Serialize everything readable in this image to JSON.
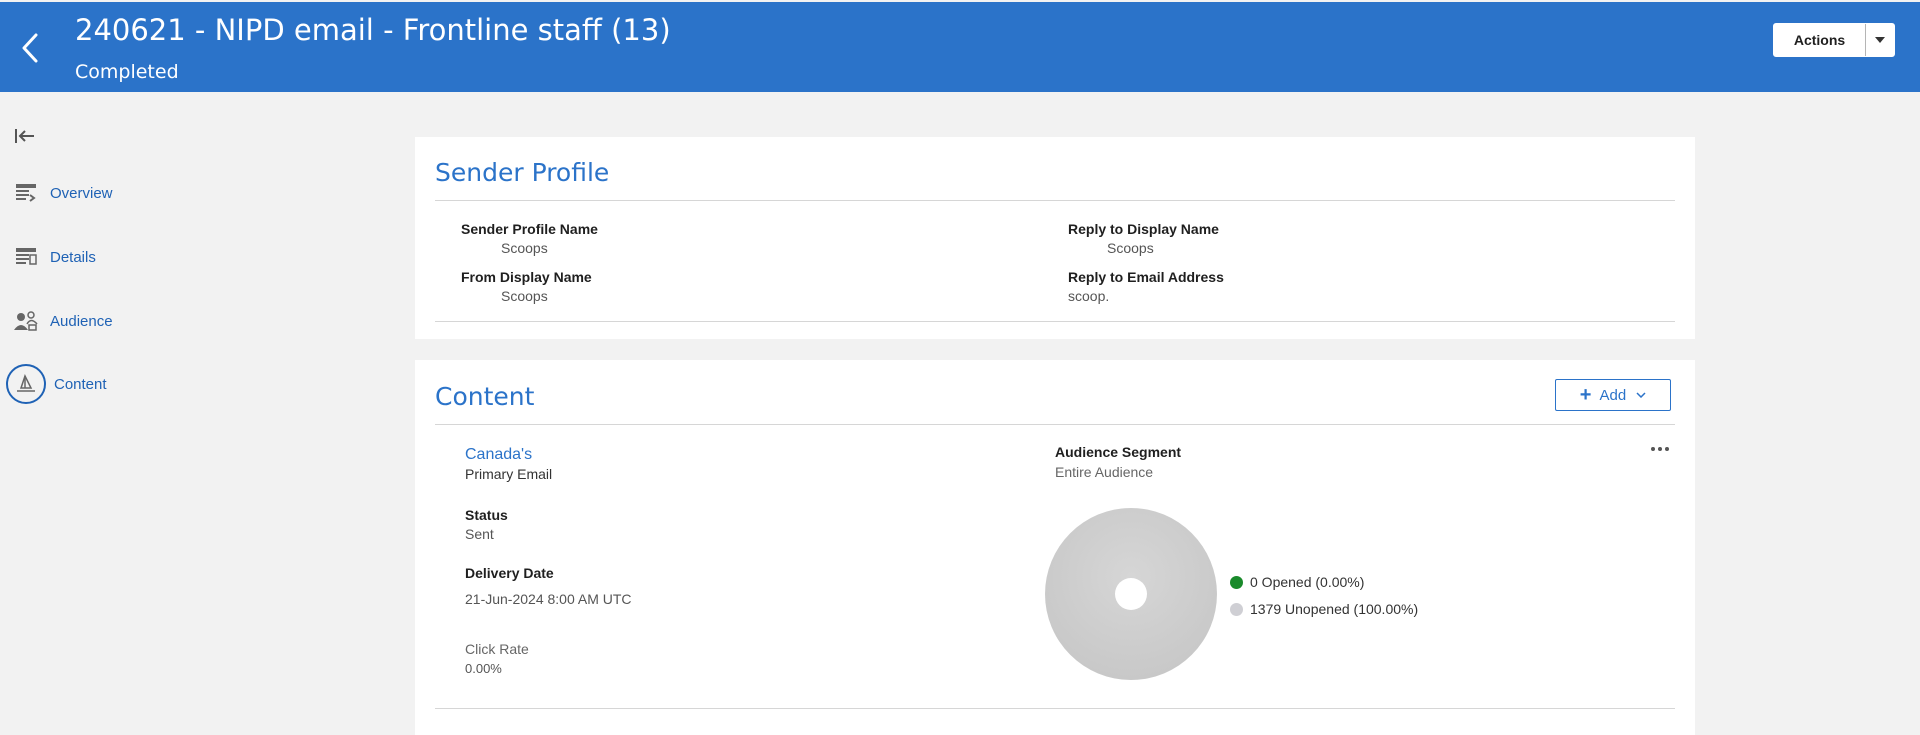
{
  "header": {
    "title": "240621 - NIPD email - Frontline staff (13)",
    "status": "Completed",
    "actions_label": "Actions"
  },
  "sidebar": {
    "items": [
      {
        "label": "Overview",
        "icon": "overview-icon"
      },
      {
        "label": "Details",
        "icon": "details-icon"
      },
      {
        "label": "Audience",
        "icon": "audience-icon"
      },
      {
        "label": "Content",
        "icon": "content-icon",
        "active": true
      }
    ]
  },
  "sender_profile": {
    "title": "Sender Profile",
    "sender_profile_name_label": "Sender Profile Name",
    "sender_profile_name_value": "Scoops",
    "from_display_name_label": "From Display Name",
    "from_display_name_value": "Scoops",
    "reply_to_display_name_label": "Reply to Display Name",
    "reply_to_display_name_value": "Scoops",
    "reply_to_email_label": "Reply to Email Address",
    "reply_to_email_value": "scoop."
  },
  "content": {
    "title": "Content",
    "add_label": "Add",
    "email_name": "Canada's",
    "email_type": "Primary Email",
    "status_label": "Status",
    "status_value": "Sent",
    "delivery_date_label": "Delivery Date",
    "delivery_date_value": "21-Jun-2024 8:00 AM UTC",
    "click_rate_label": "Click Rate",
    "click_rate_value": "0.00%",
    "audience_segment_label": "Audience Segment",
    "audience_segment_value": "Entire Audience"
  },
  "chart_data": {
    "type": "pie",
    "series": [
      {
        "name": "Opened",
        "count": 0,
        "percent": 0.0,
        "color": "#1a8a2b",
        "legend": "0  Opened (0.00%)"
      },
      {
        "name": "Unopened",
        "count": 1379,
        "percent": 100.0,
        "color": "#cfcfd4",
        "legend": "1379  Unopened (100.00%)"
      }
    ],
    "legend_position": "right"
  },
  "colors": {
    "brand": "#2b73c9",
    "link": "#1f62b5"
  }
}
